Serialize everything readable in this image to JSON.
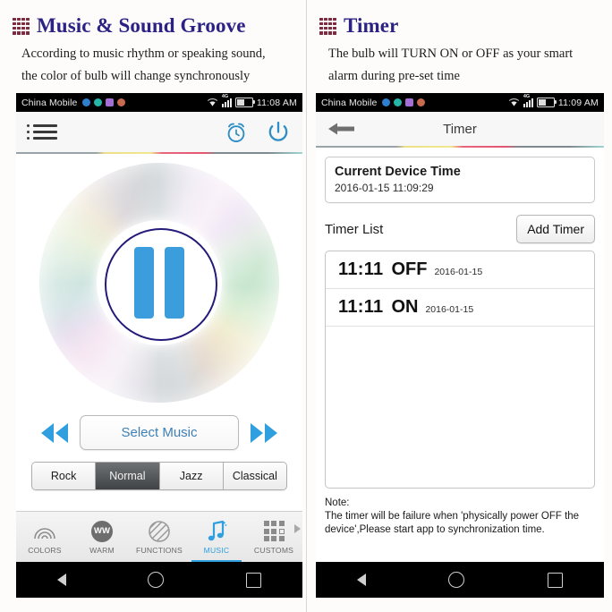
{
  "left_panel": {
    "icon": "grid-icon",
    "title": "Music & Sound Groove",
    "description_line1": "According to music rhythm or speaking sound,",
    "description_line2": "the color of bulb will change synchronously",
    "statusbar": {
      "carrier": "China Mobile",
      "network": "4G",
      "time": "11:08 AM"
    },
    "toolbar": {
      "menu_icon": "list-menu-icon",
      "alarm_icon": "alarm-clock-icon",
      "power_icon": "power-icon"
    },
    "player": {
      "disc_icon": "cd-disc-icon",
      "transport_state": "pause",
      "prev_icon": "rewind-icon",
      "next_icon": "fast-forward-icon",
      "select_music_label": "Select Music"
    },
    "modes": [
      {
        "label": "Rock",
        "selected": false
      },
      {
        "label": "Normal",
        "selected": true
      },
      {
        "label": "Jazz",
        "selected": false
      },
      {
        "label": "Classical",
        "selected": false
      }
    ],
    "tabs": [
      {
        "label": "COLORS",
        "icon": "rainbow-icon",
        "active": false
      },
      {
        "label": "WARM",
        "icon": "ww-circle-icon",
        "active": false
      },
      {
        "label": "FUNCTIONS",
        "icon": "striped-circle-icon",
        "active": false
      },
      {
        "label": "MUSIC",
        "icon": "music-note-icon",
        "active": true
      },
      {
        "label": "CUSTOMS",
        "icon": "grid-squares-icon",
        "active": false
      }
    ],
    "tabs_more_icon": "chevron-right-icon",
    "navbar": {
      "back_icon": "android-back-icon",
      "home_icon": "android-home-icon",
      "recents_icon": "android-recents-icon"
    }
  },
  "right_panel": {
    "icon": "grid-icon",
    "title": "Timer",
    "description_line1": "The bulb will TURN ON or OFF as your smart",
    "description_line2": "alarm during pre-set time",
    "statusbar": {
      "carrier": "China Mobile",
      "network": "4G",
      "time": "11:09 AM"
    },
    "topbar": {
      "back_icon": "back-arrow-icon",
      "title": "Timer"
    },
    "current_device_time": {
      "label": "Current Device Time",
      "value": "2016-01-15 11:09:29"
    },
    "timer_list_label": "Timer List",
    "add_timer_label": "Add Timer",
    "timers": [
      {
        "time": "11:11",
        "state": "OFF",
        "date": "2016-01-15"
      },
      {
        "time": "11:11",
        "state": "ON",
        "date": "2016-01-15"
      }
    ],
    "note_label": "Note:",
    "note_line1": "The timer will be failure when 'physically power OFF the",
    "note_line2": "device',Please start app to synchronization time.",
    "navbar": {
      "back_icon": "android-back-icon",
      "home_icon": "android-home-icon",
      "recents_icon": "android-recents-icon"
    }
  },
  "colors": {
    "title": "#2b2283",
    "grid_icon": "#7d2b3f",
    "accent_blue": "#2f9fe0",
    "ring_navy": "#241a7a",
    "pause_blue": "#3c9ddd",
    "statusbar_bg": "#000000"
  }
}
